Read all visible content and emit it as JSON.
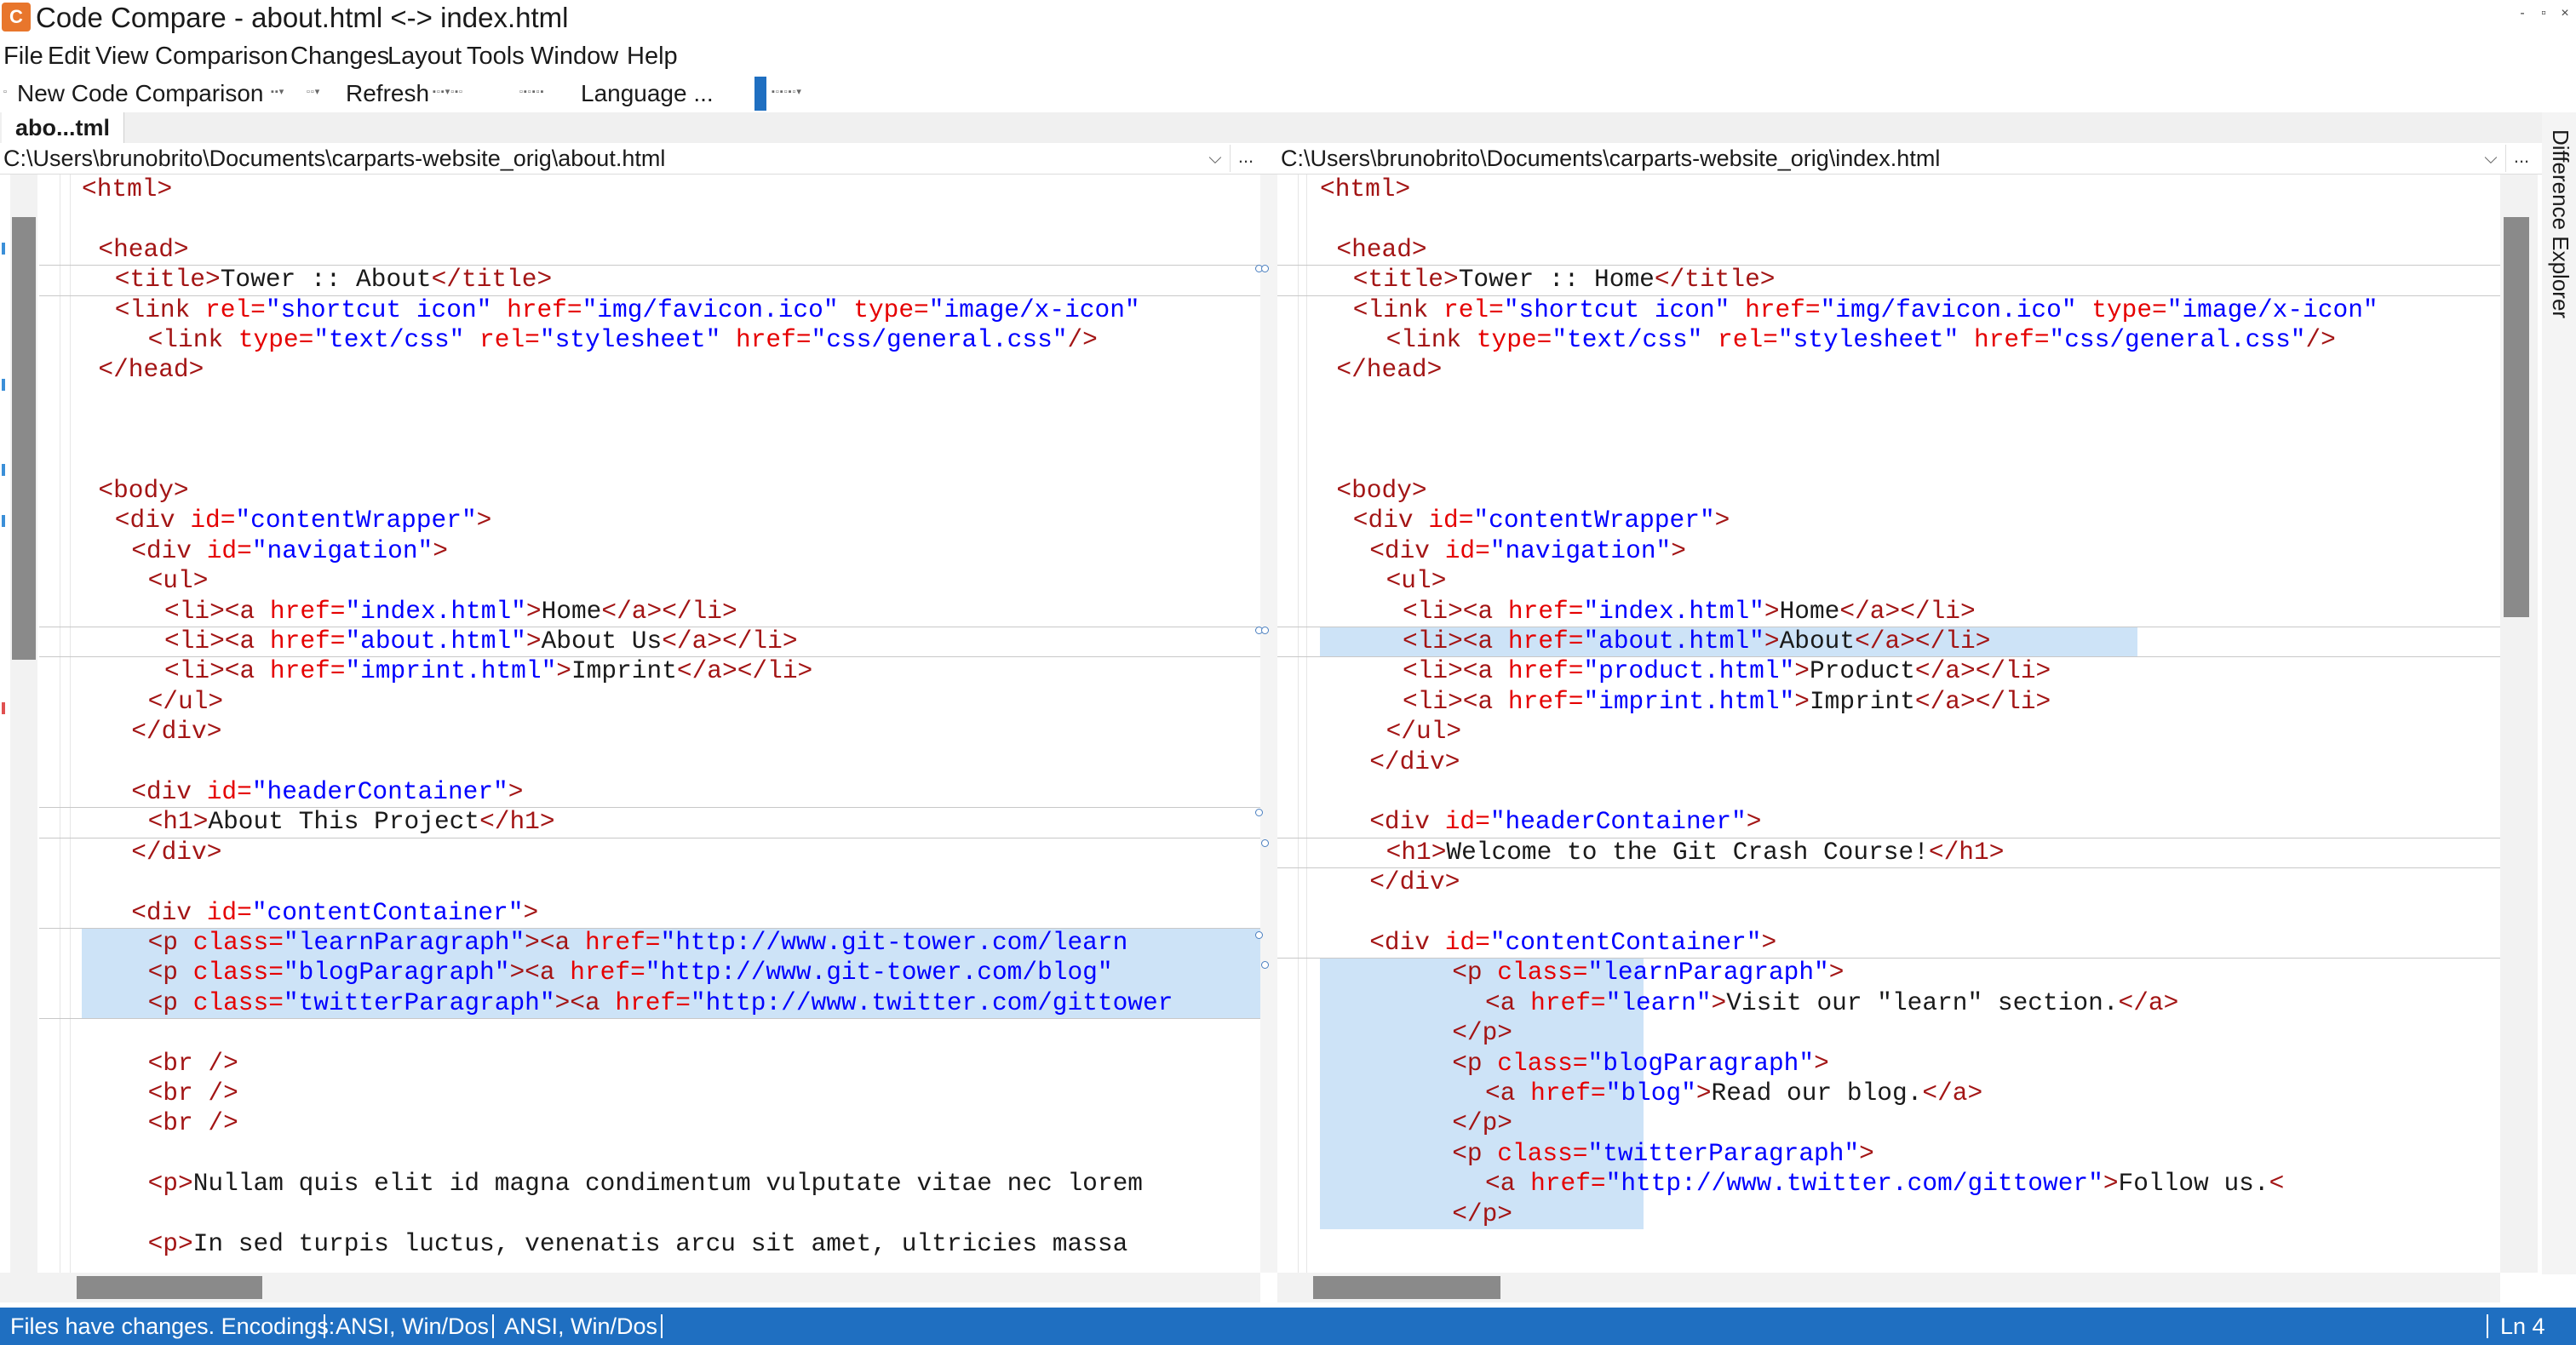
{
  "window": {
    "title": "Code Compare - about.html <-> index.html",
    "controls": [
      "-",
      "▫",
      "×"
    ]
  },
  "menu": [
    "File",
    "Edit",
    "View",
    "Comparison",
    "Changes",
    "Layout",
    "Tools",
    "Window",
    "Help"
  ],
  "toolbar": {
    "new_comparison": "New Code Comparison",
    "refresh": "Refresh",
    "language": "Language ..."
  },
  "tab": {
    "label": "abo...tml"
  },
  "left": {
    "path": "C:\\Users\\brunobrito\\Documents\\carparts-website_orig\\about.html"
  },
  "right": {
    "path": "C:\\Users\\brunobrito\\Documents\\carparts-website_orig\\index.html"
  },
  "sidebar": {
    "difference_explorer": "Difference Explorer"
  },
  "status": {
    "message": "Files have changes. Encodings:",
    "encoding_left": "ANSI, Win/Dos",
    "encoding_right": "ANSI, Win/Dos",
    "line": "Ln 4"
  },
  "colors": {
    "accent": "#1f6fc1",
    "change_highlight": "#cde3f7",
    "tag": "#a31515",
    "attribute": "#e50000",
    "string": "#0000ff"
  },
  "icons": [
    "app-icon",
    "chevron-down-icon",
    "more-icon"
  ],
  "left_lines": [
    {
      "row": 0,
      "indent": 0,
      "parts": [
        [
          "tag",
          "<html>"
        ]
      ]
    },
    {
      "row": 2,
      "indent": 1,
      "parts": [
        [
          "tag",
          "<head>"
        ]
      ]
    },
    {
      "row": 3,
      "indent": 2,
      "parts": [
        [
          "tag",
          "<title>"
        ],
        [
          "txt",
          "Tower :: About"
        ],
        [
          "tag",
          "</title>"
        ]
      ]
    },
    {
      "row": 4,
      "indent": 2,
      "parts": [
        [
          "tag",
          "<link "
        ],
        [
          "attr",
          "rel="
        ],
        [
          "str",
          "\"shortcut icon\""
        ],
        [
          "attr",
          " href="
        ],
        [
          "str",
          "\"img/favicon.ico\""
        ],
        [
          "attr",
          " type="
        ],
        [
          "str",
          "\"image/x-icon\""
        ]
      ]
    },
    {
      "row": 5,
      "indent": 4,
      "parts": [
        [
          "tag",
          "<link "
        ],
        [
          "attr",
          "type="
        ],
        [
          "str",
          "\"text/css\""
        ],
        [
          "attr",
          " rel="
        ],
        [
          "str",
          "\"stylesheet\""
        ],
        [
          "attr",
          " href="
        ],
        [
          "str",
          "\"css/general.css\""
        ],
        [
          "tag",
          "/>"
        ]
      ]
    },
    {
      "row": 6,
      "indent": 1,
      "parts": [
        [
          "tag",
          "</head>"
        ]
      ]
    },
    {
      "row": 10,
      "indent": 1,
      "parts": [
        [
          "tag",
          "<body>"
        ]
      ]
    },
    {
      "row": 11,
      "indent": 2,
      "parts": [
        [
          "tag",
          "<div "
        ],
        [
          "attr",
          "id="
        ],
        [
          "str",
          "\"contentWrapper\""
        ],
        [
          "tag",
          ">"
        ]
      ]
    },
    {
      "row": 12,
      "indent": 3,
      "parts": [
        [
          "tag",
          "<div "
        ],
        [
          "attr",
          "id="
        ],
        [
          "str",
          "\"navigation\""
        ],
        [
          "tag",
          ">"
        ]
      ]
    },
    {
      "row": 13,
      "indent": 4,
      "parts": [
        [
          "tag",
          "<ul>"
        ]
      ]
    },
    {
      "row": 14,
      "indent": 5,
      "parts": [
        [
          "tag",
          "<li><a "
        ],
        [
          "attr",
          "href="
        ],
        [
          "str",
          "\"index.html\""
        ],
        [
          "tag",
          ">"
        ],
        [
          "txt",
          "Home"
        ],
        [
          "tag",
          "</a></li>"
        ]
      ]
    },
    {
      "row": 15,
      "indent": 5,
      "parts": [
        [
          "tag",
          "<li><a "
        ],
        [
          "attr",
          "href="
        ],
        [
          "str",
          "\"about.html\""
        ],
        [
          "tag",
          ">"
        ],
        [
          "txt",
          "About Us"
        ],
        [
          "tag",
          "</a></li>"
        ]
      ]
    },
    {
      "row": 16,
      "indent": 5,
      "parts": [
        [
          "tag",
          "<li><a "
        ],
        [
          "attr",
          "href="
        ],
        [
          "str",
          "\"imprint.html\""
        ],
        [
          "tag",
          ">"
        ],
        [
          "txt",
          "Imprint"
        ],
        [
          "tag",
          "</a></li>"
        ]
      ]
    },
    {
      "row": 17,
      "indent": 4,
      "parts": [
        [
          "tag",
          "</ul>"
        ]
      ]
    },
    {
      "row": 18,
      "indent": 3,
      "parts": [
        [
          "tag",
          "</div>"
        ]
      ]
    },
    {
      "row": 20,
      "indent": 3,
      "parts": [
        [
          "tag",
          "<div "
        ],
        [
          "attr",
          "id="
        ],
        [
          "str",
          "\"headerContainer\""
        ],
        [
          "tag",
          ">"
        ]
      ]
    },
    {
      "row": 21,
      "indent": 4,
      "parts": [
        [
          "tag",
          "<h1>"
        ],
        [
          "txt",
          "About This Project"
        ],
        [
          "tag",
          "</h1>"
        ]
      ]
    },
    {
      "row": 22,
      "indent": 3,
      "parts": [
        [
          "tag",
          "</div>"
        ]
      ]
    },
    {
      "row": 24,
      "indent": 3,
      "parts": [
        [
          "tag",
          "<div "
        ],
        [
          "attr",
          "id="
        ],
        [
          "str",
          "\"contentContainer\""
        ],
        [
          "tag",
          ">"
        ]
      ]
    },
    {
      "row": 25,
      "indent": 4,
      "parts": [
        [
          "tag",
          "<p "
        ],
        [
          "attr",
          "class="
        ],
        [
          "str",
          "\"learnParagraph\""
        ],
        [
          "tag",
          ">"
        ],
        [
          "tag",
          "<a "
        ],
        [
          "attr",
          "href="
        ],
        [
          "str",
          "\"http://www.git-tower.com/learn"
        ]
      ]
    },
    {
      "row": 26,
      "indent": 4,
      "parts": [
        [
          "tag",
          "<p "
        ],
        [
          "attr",
          "class="
        ],
        [
          "str",
          "\"blogParagraph\""
        ],
        [
          "tag",
          ">"
        ],
        [
          "tag",
          "<a "
        ],
        [
          "attr",
          "href="
        ],
        [
          "str",
          "\"http://www.git-tower.com/blog\""
        ]
      ]
    },
    {
      "row": 27,
      "indent": 4,
      "parts": [
        [
          "tag",
          "<p "
        ],
        [
          "attr",
          "class="
        ],
        [
          "str",
          "\"twitterParagraph\""
        ],
        [
          "tag",
          ">"
        ],
        [
          "tag",
          "<a "
        ],
        [
          "attr",
          "href="
        ],
        [
          "str",
          "\"http://www.twitter.com/gittower"
        ]
      ]
    },
    {
      "row": 29,
      "indent": 4,
      "parts": [
        [
          "tag",
          "<br />"
        ]
      ]
    },
    {
      "row": 30,
      "indent": 4,
      "parts": [
        [
          "tag",
          "<br />"
        ]
      ]
    },
    {
      "row": 31,
      "indent": 4,
      "parts": [
        [
          "tag",
          "<br />"
        ]
      ]
    },
    {
      "row": 33,
      "indent": 4,
      "parts": [
        [
          "tag",
          "<p>"
        ],
        [
          "txt",
          "Nullam quis elit id magna condimentum vulputate vitae nec lorem"
        ]
      ]
    },
    {
      "row": 35,
      "indent": 4,
      "parts": [
        [
          "tag",
          "<p>"
        ],
        [
          "txt",
          "In sed turpis luctus, venenatis arcu sit amet, ultricies massa"
        ]
      ]
    }
  ],
  "right_lines": [
    {
      "row": 0,
      "indent": 0,
      "parts": [
        [
          "tag",
          "<html>"
        ]
      ]
    },
    {
      "row": 2,
      "indent": 1,
      "parts": [
        [
          "tag",
          "<head>"
        ]
      ]
    },
    {
      "row": 3,
      "indent": 2,
      "parts": [
        [
          "tag",
          "<title>"
        ],
        [
          "txt",
          "Tower :: Home"
        ],
        [
          "tag",
          "</title>"
        ]
      ]
    },
    {
      "row": 4,
      "indent": 2,
      "parts": [
        [
          "tag",
          "<link "
        ],
        [
          "attr",
          "rel="
        ],
        [
          "str",
          "\"shortcut icon\""
        ],
        [
          "attr",
          " href="
        ],
        [
          "str",
          "\"img/favicon.ico\""
        ],
        [
          "attr",
          " type="
        ],
        [
          "str",
          "\"image/x-icon\""
        ]
      ]
    },
    {
      "row": 5,
      "indent": 4,
      "parts": [
        [
          "tag",
          "<link "
        ],
        [
          "attr",
          "type="
        ],
        [
          "str",
          "\"text/css\""
        ],
        [
          "attr",
          " rel="
        ],
        [
          "str",
          "\"stylesheet\""
        ],
        [
          "attr",
          " href="
        ],
        [
          "str",
          "\"css/general.css\""
        ],
        [
          "tag",
          "/>"
        ]
      ]
    },
    {
      "row": 6,
      "indent": 1,
      "parts": [
        [
          "tag",
          "</head>"
        ]
      ]
    },
    {
      "row": 10,
      "indent": 1,
      "parts": [
        [
          "tag",
          "<body>"
        ]
      ]
    },
    {
      "row": 11,
      "indent": 2,
      "parts": [
        [
          "tag",
          "<div "
        ],
        [
          "attr",
          "id="
        ],
        [
          "str",
          "\"contentWrapper\""
        ],
        [
          "tag",
          ">"
        ]
      ]
    },
    {
      "row": 12,
      "indent": 3,
      "parts": [
        [
          "tag",
          "<div "
        ],
        [
          "attr",
          "id="
        ],
        [
          "str",
          "\"navigation\""
        ],
        [
          "tag",
          ">"
        ]
      ]
    },
    {
      "row": 13,
      "indent": 4,
      "parts": [
        [
          "tag",
          "<ul>"
        ]
      ]
    },
    {
      "row": 14,
      "indent": 5,
      "parts": [
        [
          "tag",
          "<li><a "
        ],
        [
          "attr",
          "href="
        ],
        [
          "str",
          "\"index.html\""
        ],
        [
          "tag",
          ">"
        ],
        [
          "txt",
          "Home"
        ],
        [
          "tag",
          "</a></li>"
        ]
      ]
    },
    {
      "row": 15,
      "indent": 5,
      "parts": [
        [
          "tag",
          "<li><a "
        ],
        [
          "attr",
          "href="
        ],
        [
          "str",
          "\"about.html\""
        ],
        [
          "tag",
          ">"
        ],
        [
          "txt",
          "About"
        ],
        [
          "tag",
          "</a></li>"
        ]
      ]
    },
    {
      "row": 16,
      "indent": 5,
      "parts": [
        [
          "tag",
          "<li><a "
        ],
        [
          "attr",
          "href="
        ],
        [
          "str",
          "\"product.html\""
        ],
        [
          "tag",
          ">"
        ],
        [
          "txt",
          "Product"
        ],
        [
          "tag",
          "</a></li>"
        ]
      ]
    },
    {
      "row": 17,
      "indent": 5,
      "parts": [
        [
          "tag",
          "<li><a "
        ],
        [
          "attr",
          "href="
        ],
        [
          "str",
          "\"imprint.html\""
        ],
        [
          "tag",
          ">"
        ],
        [
          "txt",
          "Imprint"
        ],
        [
          "tag",
          "</a></li>"
        ]
      ]
    },
    {
      "row": 18,
      "indent": 4,
      "parts": [
        [
          "tag",
          "</ul>"
        ]
      ]
    },
    {
      "row": 19,
      "indent": 3,
      "parts": [
        [
          "tag",
          "</div>"
        ]
      ]
    },
    {
      "row": 21,
      "indent": 3,
      "parts": [
        [
          "tag",
          "<div "
        ],
        [
          "attr",
          "id="
        ],
        [
          "str",
          "\"headerContainer\""
        ],
        [
          "tag",
          ">"
        ]
      ]
    },
    {
      "row": 22,
      "indent": 4,
      "parts": [
        [
          "tag",
          "<h1>"
        ],
        [
          "txt",
          "Welcome to the Git Crash Course!"
        ],
        [
          "tag",
          "</h1>"
        ]
      ]
    },
    {
      "row": 23,
      "indent": 3,
      "parts": [
        [
          "tag",
          "</div>"
        ]
      ]
    },
    {
      "row": 25,
      "indent": 3,
      "parts": [
        [
          "tag",
          "<div "
        ],
        [
          "attr",
          "id="
        ],
        [
          "str",
          "\"contentContainer\""
        ],
        [
          "tag",
          ">"
        ]
      ]
    },
    {
      "row": 26,
      "indent": 8,
      "parts": [
        [
          "tag",
          "<p "
        ],
        [
          "attr",
          "class="
        ],
        [
          "str",
          "\"learnParagraph\""
        ],
        [
          "tag",
          ">"
        ]
      ]
    },
    {
      "row": 27,
      "indent": 10,
      "parts": [
        [
          "tag",
          "<a "
        ],
        [
          "attr",
          "href="
        ],
        [
          "str",
          "\"learn\""
        ],
        [
          "tag",
          ">"
        ],
        [
          "txt",
          "Visit our \"learn\" section."
        ],
        [
          "tag",
          "</a>"
        ]
      ]
    },
    {
      "row": 28,
      "indent": 8,
      "parts": [
        [
          "tag",
          "</p>"
        ]
      ]
    },
    {
      "row": 29,
      "indent": 8,
      "parts": [
        [
          "tag",
          "<p "
        ],
        [
          "attr",
          "class="
        ],
        [
          "str",
          "\"blogParagraph\""
        ],
        [
          "tag",
          ">"
        ]
      ]
    },
    {
      "row": 30,
      "indent": 10,
      "parts": [
        [
          "tag",
          "<a "
        ],
        [
          "attr",
          "href="
        ],
        [
          "str",
          "\"blog\""
        ],
        [
          "tag",
          ">"
        ],
        [
          "txt",
          "Read our blog."
        ],
        [
          "tag",
          "</a>"
        ]
      ]
    },
    {
      "row": 31,
      "indent": 8,
      "parts": [
        [
          "tag",
          "</p>"
        ]
      ]
    },
    {
      "row": 32,
      "indent": 8,
      "parts": [
        [
          "tag",
          "<p "
        ],
        [
          "attr",
          "class="
        ],
        [
          "str",
          "\"twitterParagraph\""
        ],
        [
          "tag",
          ">"
        ]
      ]
    },
    {
      "row": 33,
      "indent": 10,
      "parts": [
        [
          "tag",
          "<a "
        ],
        [
          "attr",
          "href="
        ],
        [
          "str",
          "\"http://www.twitter.com/gittower\""
        ],
        [
          "tag",
          ">"
        ],
        [
          "txt",
          "Follow us."
        ],
        [
          "tag",
          "<"
        ]
      ]
    },
    {
      "row": 34,
      "indent": 8,
      "parts": [
        [
          "tag",
          "</p>"
        ]
      ]
    }
  ]
}
